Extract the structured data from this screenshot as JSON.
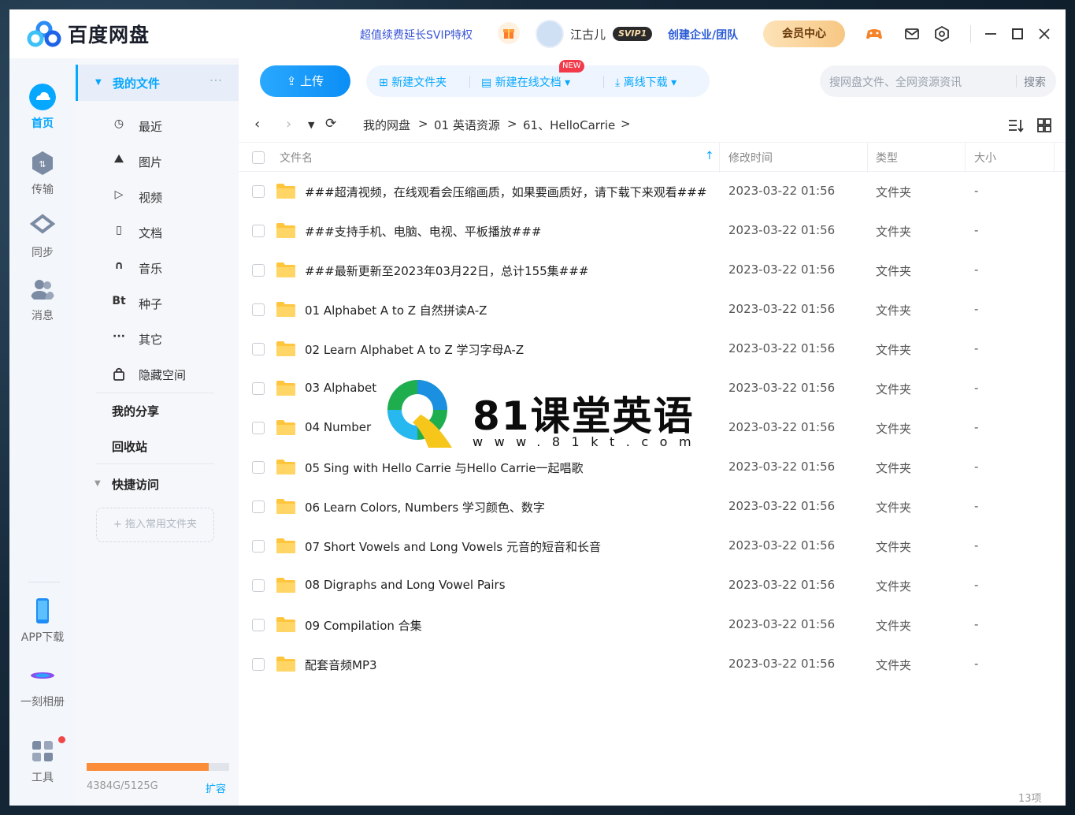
{
  "titlebar": {
    "brand": "百度网盘",
    "promo": "超值续费延长SVIP特权",
    "username": "江古儿",
    "svip_badge": "SVIP1",
    "enterprise": "创建企业/团队",
    "vip_center": "会员中心"
  },
  "rail": {
    "items": [
      {
        "label": "首页",
        "icon": "home-cloud-icon"
      },
      {
        "label": "传输",
        "icon": "transfer-icon"
      },
      {
        "label": "同步",
        "icon": "sync-icon"
      },
      {
        "label": "消息",
        "icon": "message-icon"
      },
      {
        "label": "APP下载",
        "icon": "phone-icon"
      },
      {
        "label": "一刻相册",
        "icon": "album-icon"
      },
      {
        "label": "工具",
        "icon": "tools-icon"
      }
    ]
  },
  "nav": {
    "my_files": "我的文件",
    "items": [
      {
        "label": "最近",
        "icon": "clock-icon",
        "glyph": "◷"
      },
      {
        "label": "图片",
        "icon": "image-icon",
        "glyph": "⛰"
      },
      {
        "label": "视频",
        "icon": "video-icon",
        "glyph": "▷"
      },
      {
        "label": "文档",
        "icon": "document-icon",
        "glyph": "▯"
      },
      {
        "label": "音乐",
        "icon": "headphones-icon",
        "glyph": "∩"
      },
      {
        "label": "种子",
        "icon": "bt-icon",
        "glyph": "Bt"
      },
      {
        "label": "其它",
        "icon": "more-icon",
        "glyph": "···"
      },
      {
        "label": "隐藏空间",
        "icon": "lock-icon",
        "glyph": "🔒"
      }
    ],
    "my_share": "我的分享",
    "recycle": "回收站",
    "quick_access": "快捷访问",
    "drop_hint": "+ 拖入常用文件夹",
    "storage_text": "4384G/5125G",
    "storage_used_fraction": 0.855,
    "expand": "扩容"
  },
  "toolbar": {
    "upload": "上传",
    "new_folder": "新建文件夹",
    "new_doc": "新建在线文档",
    "new_badge": "NEW",
    "offline": "离线下载",
    "search_placeholder": "搜网盘文件、全网资源资讯",
    "search_button": "搜索"
  },
  "breadcrumb": [
    "我的网盘",
    "01 英语资源",
    "61、HelloCarrie"
  ],
  "table": {
    "headers": {
      "name": "文件名",
      "modified": "修改时间",
      "type": "类型",
      "size": "大小"
    },
    "rows": [
      {
        "name": "###超清视频，在线观看会压缩画质，如果要画质好，请下载下来观看###",
        "modified": "2023-03-22 01:56",
        "type": "文件夹",
        "size": "-"
      },
      {
        "name": "###支持手机、电脑、电视、平板播放###",
        "modified": "2023-03-22 01:56",
        "type": "文件夹",
        "size": "-"
      },
      {
        "name": "###最新更新至2023年03月22日，总计155集###",
        "modified": "2023-03-22 01:56",
        "type": "文件夹",
        "size": "-"
      },
      {
        "name": "01 Alphabet A to Z 自然拼读A-Z",
        "modified": "2023-03-22 01:56",
        "type": "文件夹",
        "size": "-"
      },
      {
        "name": "02 Learn Alphabet A to Z 学习字母A-Z",
        "modified": "2023-03-22 01:56",
        "type": "文件夹",
        "size": "-"
      },
      {
        "name": "03 Alphabet",
        "modified": "2023-03-22 01:56",
        "type": "文件夹",
        "size": "-"
      },
      {
        "name": "04 Number",
        "modified": "2023-03-22 01:56",
        "type": "文件夹",
        "size": "-"
      },
      {
        "name": "05 Sing with Hello Carrie 与Hello Carrie一起唱歌",
        "modified": "2023-03-22 01:56",
        "type": "文件夹",
        "size": "-"
      },
      {
        "name": "06 Learn Colors, Numbers 学习颜色、数字",
        "modified": "2023-03-22 01:56",
        "type": "文件夹",
        "size": "-"
      },
      {
        "name": "07 Short Vowels and Long Vowels 元音的短音和长音",
        "modified": "2023-03-22 01:56",
        "type": "文件夹",
        "size": "-"
      },
      {
        "name": "08 Digraphs and Long Vowel Pairs",
        "modified": "2023-03-22 01:56",
        "type": "文件夹",
        "size": "-"
      },
      {
        "name": "09 Compilation 合集",
        "modified": "2023-03-22 01:56",
        "type": "文件夹",
        "size": "-"
      },
      {
        "name": "配套音频MP3",
        "modified": "2023-03-22 01:56",
        "type": "文件夹",
        "size": "-"
      }
    ],
    "count": "13项"
  },
  "watermark": {
    "title": "81课堂英语",
    "url": "www.81kt.com"
  },
  "colors": {
    "accent": "#06a7ff",
    "folder": "#ffc53d",
    "storage": "#fb8c3a"
  }
}
